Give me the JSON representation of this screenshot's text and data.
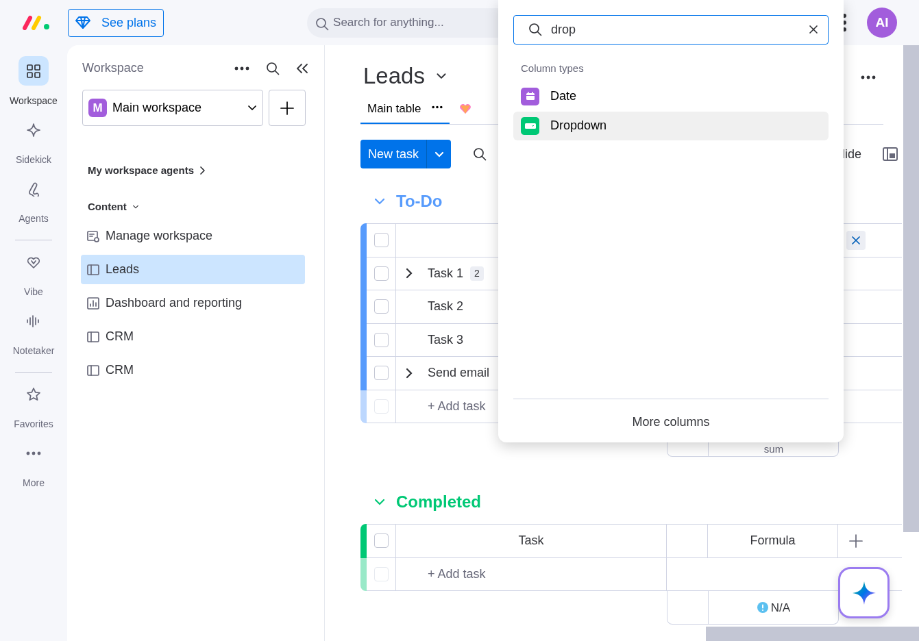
{
  "topbar": {
    "see_plans": "See plans",
    "search": {
      "placeholder": "Search for anything..."
    },
    "avatar": "AI"
  },
  "rail_groups": [
    {
      "items": [
        {
          "label": "Workspace",
          "selected": true
        },
        {
          "label": "Sidekick",
          "selected": false
        },
        {
          "label": "Agents",
          "selected": false
        }
      ]
    },
    {
      "items": [
        {
          "label": "Vibe",
          "selected": false
        },
        {
          "label": "Notetaker",
          "selected": false
        }
      ]
    },
    {
      "items": [
        {
          "label": "Favorites",
          "selected": false
        },
        {
          "label": "More",
          "selected": false
        }
      ]
    }
  ],
  "panel": {
    "title": "Workspace",
    "workspace": {
      "initial": "M",
      "name": "Main workspace"
    },
    "agents_link": "My workspace agents",
    "content": {
      "label": "Content",
      "expanded": true
    },
    "items": [
      {
        "label": "Manage workspace",
        "kind": "settings",
        "selected": false
      },
      {
        "label": "Leads",
        "kind": "board",
        "selected": true
      },
      {
        "label": "Dashboard and reporting",
        "kind": "dashboard",
        "selected": false
      },
      {
        "label": "CRM",
        "kind": "board",
        "selected": false
      },
      {
        "label": "CRM",
        "kind": "board",
        "selected": false
      }
    ]
  },
  "board": {
    "title": "Leads",
    "tabs": [
      {
        "label": "Main table",
        "selected": true
      }
    ],
    "new_task": "New task",
    "hide_partial": "lide"
  },
  "groups": [
    {
      "title": "To-Do",
      "color": "#579bfc",
      "expanded": true,
      "header": {
        "kind": "editing",
        "checked": false
      },
      "rows": [
        {
          "name": "Task 1",
          "checked": false,
          "expandable": true,
          "subitems": "2"
        },
        {
          "name": "Task 2",
          "checked": false,
          "expandable": false
        },
        {
          "name": "Task 3",
          "checked": false,
          "expandable": false
        },
        {
          "name": "Send email",
          "checked": false,
          "expandable": true
        }
      ],
      "add_row": {
        "label": "+ Add task",
        "checkbox_disabled": true
      },
      "summary": {
        "kind": "text",
        "text": "sum"
      }
    },
    {
      "title": "Completed",
      "color": "#00c875",
      "expanded": true,
      "header": {
        "kind": "labels",
        "checked": false,
        "task": "Task",
        "column_4": "Formula"
      },
      "add_row": {
        "label": "+ Add task",
        "checkbox_disabled": true
      },
      "summary": {
        "kind": "warning",
        "text": "N/A"
      }
    }
  ],
  "popup": {
    "search_value": "drop",
    "section": "Column types",
    "options": [
      {
        "label": "Date",
        "kind": "date",
        "color": "#a25ddc",
        "selected": false
      },
      {
        "label": "Dropdown",
        "kind": "dropdown",
        "color": "#00c875",
        "selected": true
      }
    ],
    "more": "More columns"
  }
}
